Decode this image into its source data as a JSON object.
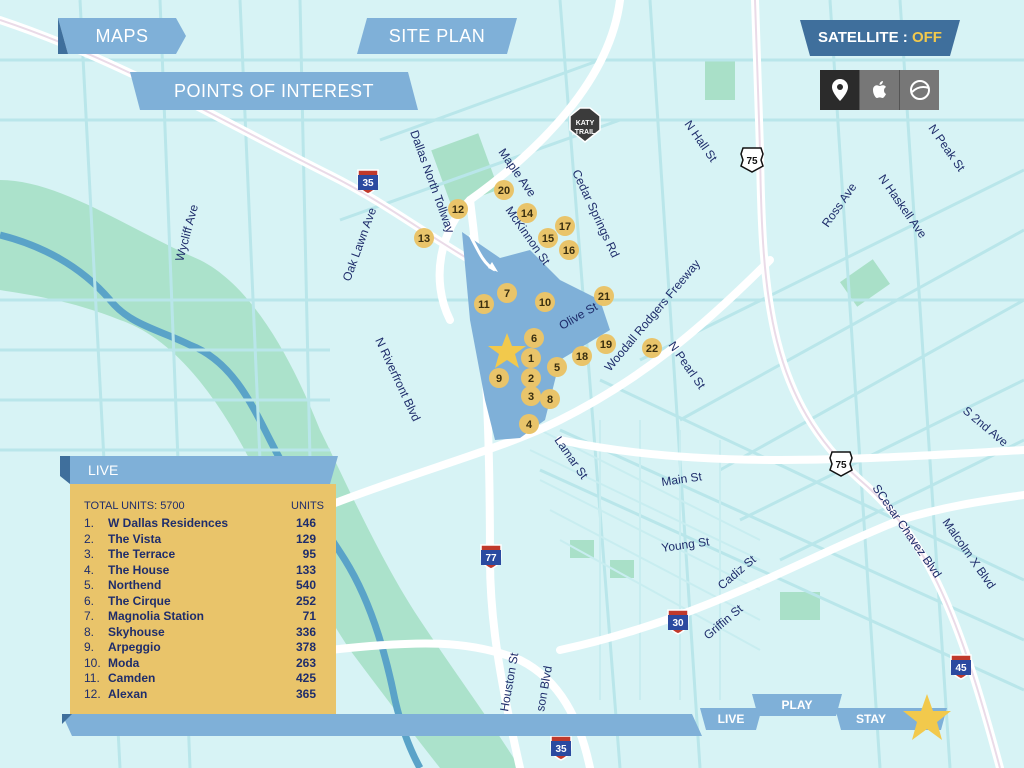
{
  "nav": {
    "maps": "MAPS",
    "site_plan": "SITE PLAN",
    "points_of_interest": "POINTS OF INTEREST"
  },
  "satellite": {
    "label": "SATELLITE",
    "separator": ":",
    "state": "OFF"
  },
  "map_icons": [
    "pin-icon",
    "apple-icon",
    "google-earth-icon"
  ],
  "trail_logo": {
    "top": "KATY",
    "bottom": "TRAIL"
  },
  "road_labels": {
    "dallas_north_tollway": "Dallas North Tollway",
    "maple_ave": "Maple Ave",
    "mckinnon_st": "McKinnon St",
    "cedar_springs_rd": "Cedar Springs Rd",
    "n_hall_st": "N Hall St",
    "n_peak_st": "N Peak St",
    "ross_ave": "Ross Ave",
    "n_haskell_ave": "N Haskell Ave",
    "wycliff_ave": "Wycliff Ave",
    "oak_lawn_ave": "Oak Lawn Ave",
    "n_riverfront_blvd": "N Riverfront Blvd",
    "olive_st": "Olive St",
    "woodall_rodgers_fwy": "Woodall Rodgers Freeway",
    "n_pearl_st": "N Pearl St",
    "lamar_st": "Lamar St",
    "main_st": "Main St",
    "s_2nd_ave": "S 2nd Ave",
    "young_st": "Young St",
    "cadiz_st": "Cadiz St",
    "griffin_st": "Griffin St",
    "s_cesar_chavez_blvd": "SCesar Chavez Blvd",
    "malcolm_x_blvd": "Malcolm X Blvd",
    "houston_st": "Houston St",
    "jefferson_blvd": "son Blvd"
  },
  "shields": {
    "i35_top": "35",
    "us75_top": "75",
    "us75_mid": "75",
    "i77": "77",
    "i30": "30",
    "i45": "45",
    "i35_bottom": "35"
  },
  "pois": [
    "1",
    "2",
    "3",
    "4",
    "5",
    "6",
    "7",
    "8",
    "9",
    "10",
    "11",
    "12",
    "13",
    "14",
    "15",
    "16",
    "17",
    "18",
    "19",
    "20",
    "21",
    "22"
  ],
  "live": {
    "header": "LIVE",
    "total_label": "TOTAL UNITS: 5700",
    "units_label": "UNITS",
    "items": [
      {
        "num": "1.",
        "name": "W Dallas Residences",
        "units": "146"
      },
      {
        "num": "2.",
        "name": "The Vista",
        "units": "129"
      },
      {
        "num": "3.",
        "name": "The Terrace",
        "units": "95"
      },
      {
        "num": "4.",
        "name": "The House",
        "units": "133"
      },
      {
        "num": "5.",
        "name": "Northend",
        "units": "540"
      },
      {
        "num": "6.",
        "name": "The Cirque",
        "units": "252"
      },
      {
        "num": "7.",
        "name": "Magnolia Station",
        "units": "71"
      },
      {
        "num": "8.",
        "name": "Skyhouse",
        "units": "336"
      },
      {
        "num": "9.",
        "name": "Arpeggio",
        "units": "378"
      },
      {
        "num": "10.",
        "name": "Moda",
        "units": "263"
      },
      {
        "num": "11.",
        "name": "Camden",
        "units": "425"
      },
      {
        "num": "12.",
        "name": "Alexan",
        "units": "365"
      }
    ]
  },
  "bottom_tabs": {
    "live": "LIVE",
    "play": "PLAY",
    "stay": "STAY"
  },
  "colors": {
    "water": "#5aa3c8",
    "park": "#9fdcc4",
    "site": "#7fb0d8",
    "ribbon": "#6a9fd0",
    "ribbon_dark": "#3f6f9c",
    "poi": "#e9c46a",
    "star": "#f2c94c"
  }
}
